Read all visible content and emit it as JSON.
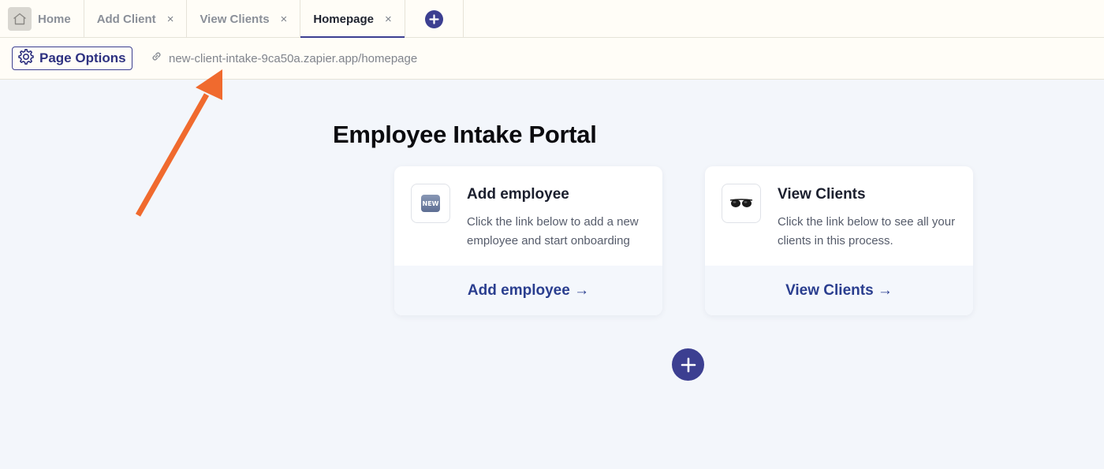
{
  "tabs": [
    {
      "label": "Home",
      "closable": false,
      "active": false,
      "icon": "home-icon"
    },
    {
      "label": "Add Client",
      "closable": true,
      "active": false
    },
    {
      "label": "View Clients",
      "closable": true,
      "active": false
    },
    {
      "label": "Homepage",
      "closable": true,
      "active": true
    }
  ],
  "close_glyph": "×",
  "options_bar": {
    "page_options_label": "Page Options",
    "url": "new-client-intake-9ca50a.zapier.app/homepage"
  },
  "main": {
    "title": "Employee Intake Portal",
    "cards": [
      {
        "icon": "new-badge-icon",
        "icon_text": "NEW",
        "title": "Add employee",
        "description": "Click the link below to add a new employee and start onboarding",
        "link": "Add employee →"
      },
      {
        "icon": "glasses-icon",
        "title": "View Clients",
        "description": "Click the link below to see all your clients in this process.",
        "link": "View Clients →"
      }
    ]
  },
  "colors": {
    "accent": "#3c3f91",
    "link": "#2a3e8f",
    "annotation_arrow": "#f06a2e",
    "background": "#f3f6fb"
  }
}
